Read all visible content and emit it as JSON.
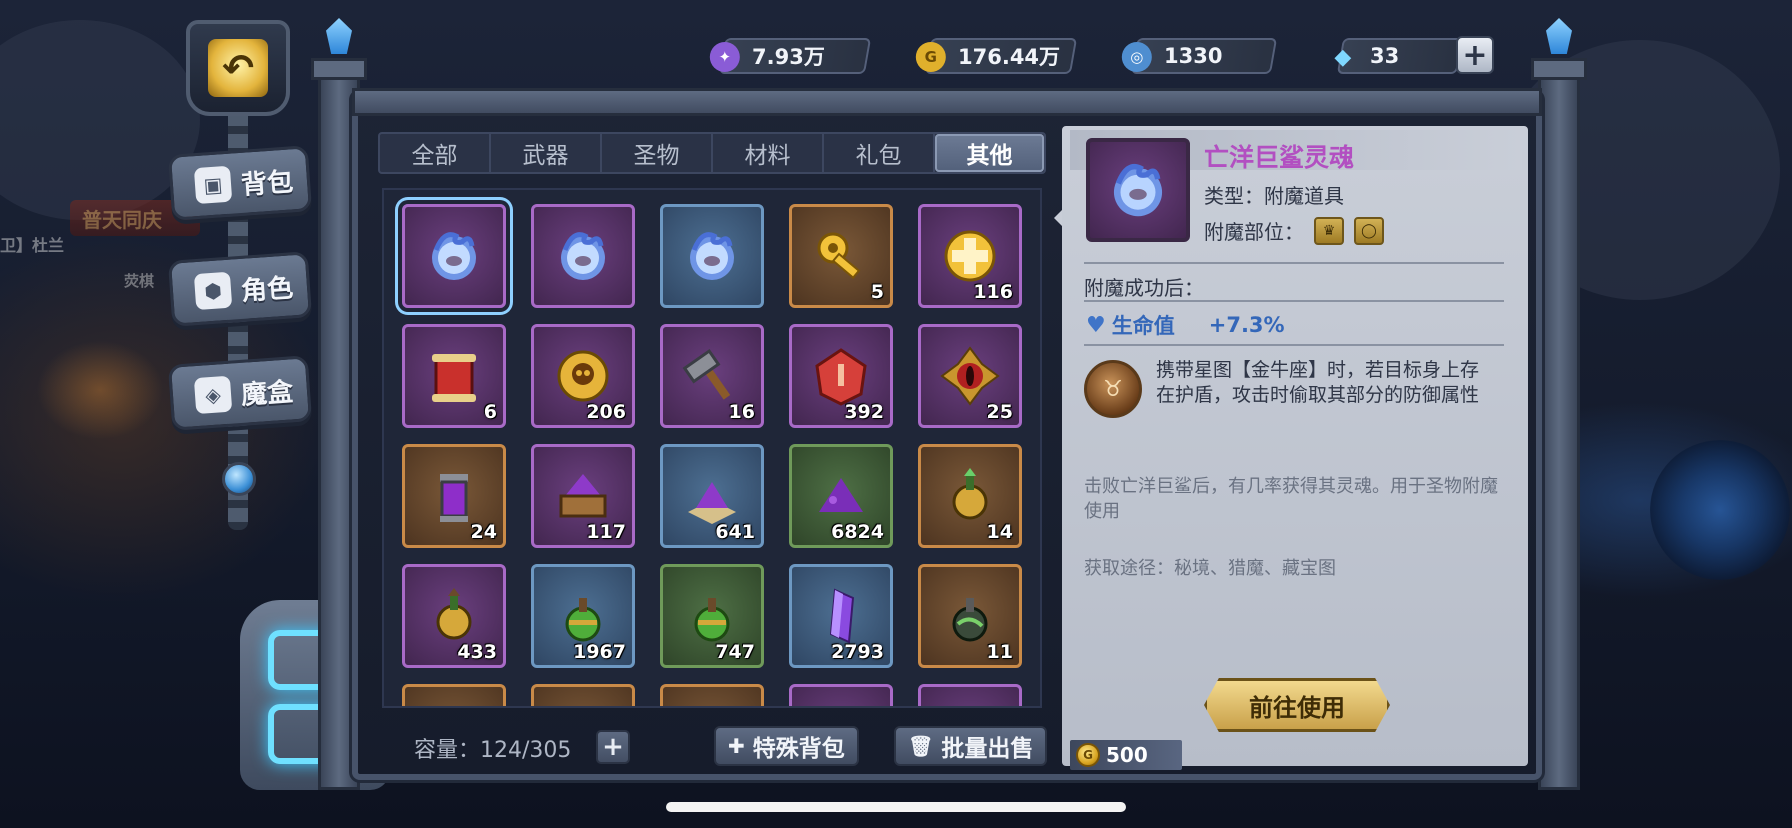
{
  "currencies": [
    {
      "name": "crystal-currency",
      "value": "7.93万",
      "icon_color": "#8a5cd6"
    },
    {
      "name": "gold",
      "value": "176.44万",
      "icon_color": "#e0b02c",
      "symbol": "G"
    },
    {
      "name": "energy",
      "value": "1330",
      "icon_color": "#4f8ed0"
    },
    {
      "name": "diamond",
      "value": "33",
      "icon_color": "#7fd8ff"
    }
  ],
  "add_currency_label": "+",
  "side_menu": [
    {
      "label": "背包",
      "icon": "bag-icon",
      "glyph": "▣"
    },
    {
      "label": "角色",
      "icon": "character-icon",
      "glyph": "⬢"
    },
    {
      "label": "魔盒",
      "icon": "magic-box-icon",
      "glyph": "◈"
    }
  ],
  "background_text": {
    "banner": "普天同庆",
    "player": "卫】杜兰",
    "npc": "荧棋"
  },
  "tabs": [
    "全部",
    "武器",
    "圣物",
    "材料",
    "礼包",
    "其他"
  ],
  "active_tab": "其他",
  "items": [
    {
      "art": "soul-orb",
      "rarity": "purple",
      "count": ""
    },
    {
      "art": "soul-orb",
      "rarity": "purple",
      "count": ""
    },
    {
      "art": "soul-orb",
      "rarity": "blue",
      "count": ""
    },
    {
      "art": "key",
      "rarity": "orange",
      "count": "5"
    },
    {
      "art": "gold-cross-coin",
      "rarity": "purple",
      "count": "116"
    },
    {
      "art": "red-scroll",
      "rarity": "purple",
      "count": "6"
    },
    {
      "art": "skull-coin",
      "rarity": "purple",
      "count": "206"
    },
    {
      "art": "hammer",
      "rarity": "purple",
      "count": "16"
    },
    {
      "art": "red-gem",
      "rarity": "purple",
      "count": "392"
    },
    {
      "art": "red-eye-gem",
      "rarity": "purple",
      "count": "25"
    },
    {
      "art": "potion-jar",
      "rarity": "orange",
      "count": "24"
    },
    {
      "art": "crate-powder",
      "rarity": "purple",
      "count": "117"
    },
    {
      "art": "powder-mat",
      "rarity": "blue",
      "count": "641"
    },
    {
      "art": "powder-pile",
      "rarity": "green",
      "count": "6824"
    },
    {
      "art": "gold-flask",
      "rarity": "orange",
      "count": "14"
    },
    {
      "art": "gold-flask-brown",
      "rarity": "purple",
      "count": "433"
    },
    {
      "art": "green-flask",
      "rarity": "blue",
      "count": "1967"
    },
    {
      "art": "green-flask",
      "rarity": "green",
      "count": "747"
    },
    {
      "art": "purple-crystal",
      "rarity": "blue",
      "count": "2793"
    },
    {
      "art": "dark-flask",
      "rarity": "orange",
      "count": "11"
    },
    {
      "art": "unknown",
      "rarity": "orange",
      "count": ""
    },
    {
      "art": "unknown",
      "rarity": "orange",
      "count": ""
    },
    {
      "art": "unknown",
      "rarity": "orange",
      "count": ""
    },
    {
      "art": "unknown",
      "rarity": "purple",
      "count": ""
    },
    {
      "art": "unknown",
      "rarity": "purple",
      "count": ""
    }
  ],
  "selected_index": 0,
  "capacity": {
    "label": "容量：124/305",
    "plus": "+"
  },
  "buttons": {
    "special_bag": "特殊背包",
    "bulk_sell": "批量出售",
    "goto_use": "前往使用"
  },
  "detail": {
    "name": "亡洋巨鲨灵魂",
    "type": "类型：附魔道具",
    "part_label": "附魔部位：",
    "after_label": "附魔成功后：",
    "stat_name": "生命值",
    "stat_value": "+7.3%",
    "rune_text": "携带星图【金牛座】时，若目标身上存在护盾，攻击时偷取其部分的防御属性",
    "description": "击败亡洋巨鲨后，有几率获得其灵魂。用于圣物附魔使用",
    "source": "获取途径：秘境、猎魔、藏宝图",
    "price": "500"
  }
}
